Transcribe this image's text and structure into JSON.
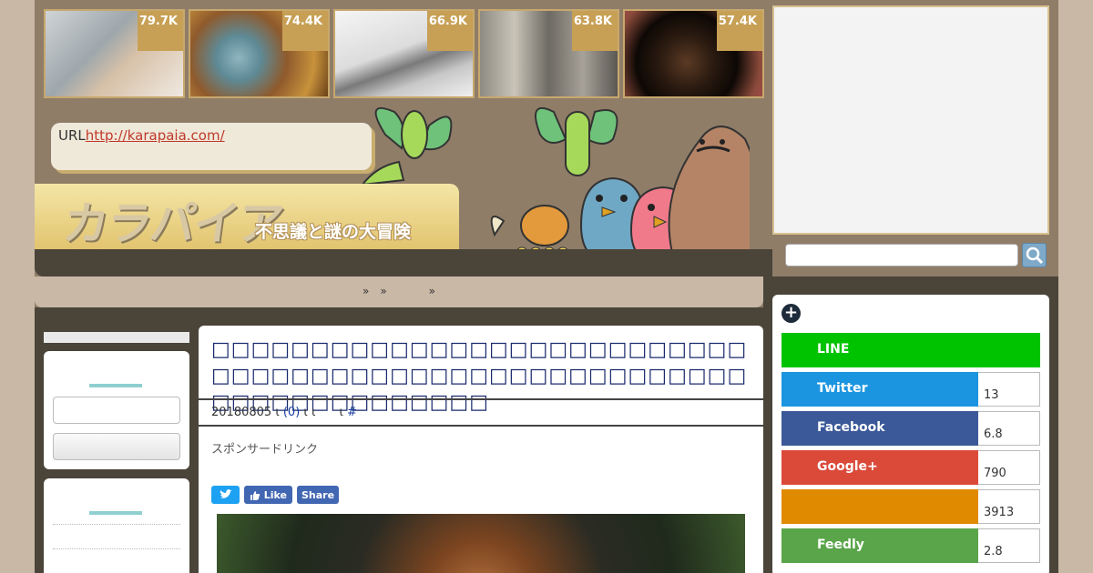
{
  "popular": [
    {
      "count": "79.7K"
    },
    {
      "count": "74.4K"
    },
    {
      "count": "66.9K"
    },
    {
      "count": "63.8K"
    },
    {
      "count": "57.4K"
    }
  ],
  "header": {
    "url_label": "URL",
    "url_link": "http://karapaia.com/",
    "logo": "カラパイア",
    "tagline": "不思議と謎の大冒険"
  },
  "breadcrumb": {
    "sep1": "»",
    "sep2": "»",
    "sep3": "»"
  },
  "article": {
    "title": "□□□□□□□□□□□□□□□□□□□□□□□□□□□□□□□□□□□□□□□□□□□□□□□□□□□□□□□□□□□□□□□□□□□□",
    "date": "20180805",
    "sep": "ι",
    "comments": "(0)",
    "sep2": "ι ι",
    "sep3": "ι",
    "hash": "#",
    "sponsor": "スポンサードリンク",
    "share": {
      "like": "Like",
      "share": "Share"
    }
  },
  "share_panel": {
    "rows": [
      {
        "name": "LINE",
        "count": "",
        "color": "#00c300"
      },
      {
        "name": "Twitter",
        "count": "13",
        "color": "#1b95e0"
      },
      {
        "name": "Facebook",
        "count": "6.8",
        "color": "#3b5998"
      },
      {
        "name": "Google+",
        "count": "790",
        "color": "#db4a39"
      },
      {
        "name": "",
        "count": "3913",
        "color": "#e08a00"
      },
      {
        "name": "Feedly",
        "count": "2.8",
        "color": "#5aa54a"
      }
    ]
  }
}
